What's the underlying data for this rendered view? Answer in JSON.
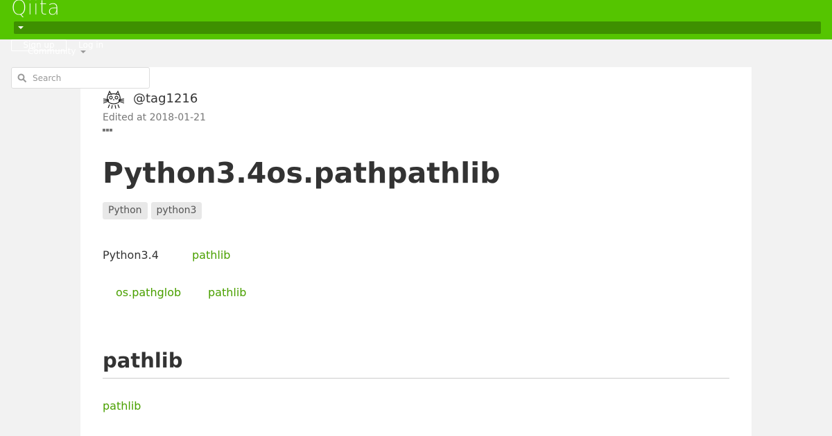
{
  "header": {
    "logo": "Qiita",
    "accent_color": "#55c500"
  },
  "auth": {
    "signup_label": "Sign up",
    "login_label": "Log in"
  },
  "nav": {
    "community_label": "Community"
  },
  "search": {
    "placeholder": "Search"
  },
  "article": {
    "author": "@tag1216",
    "edited": "Edited at 2018-01-21",
    "title": "Python3.4os.pathpathlib",
    "tags": [
      "Python",
      "python3"
    ],
    "intro_text": "Python3.4",
    "intro_link": "pathlib",
    "line2_link1": "os.pathglob",
    "line2_link2": "pathlib",
    "section_heading": "pathlib",
    "section_link": "pathlib"
  }
}
